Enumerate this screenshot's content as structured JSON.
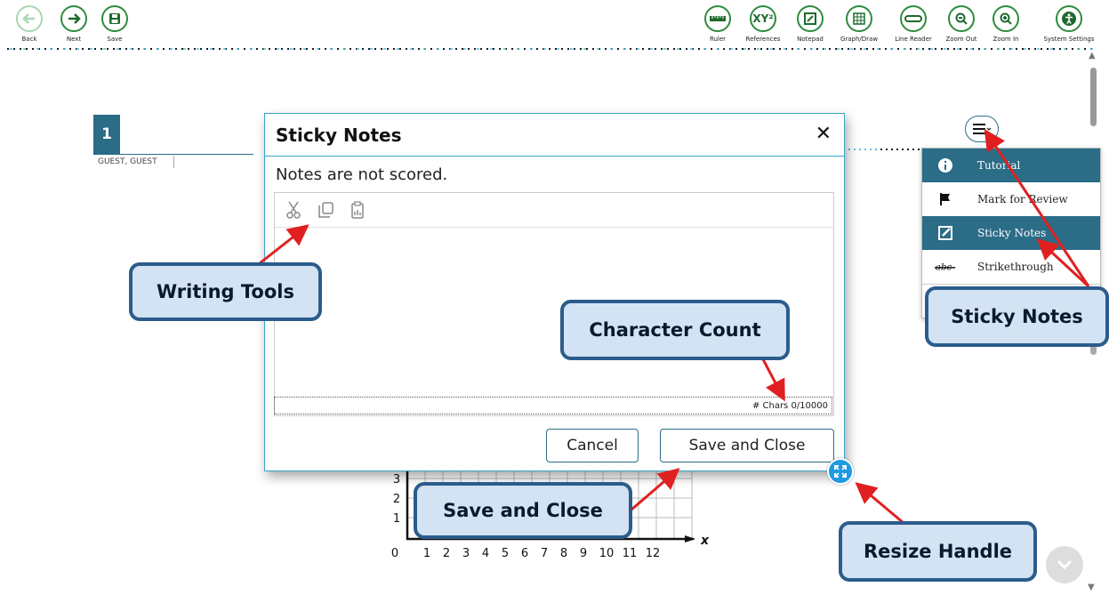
{
  "toolbar": {
    "left": [
      {
        "label": "Back",
        "icon": "back-arrow-icon",
        "disabled": true
      },
      {
        "label": "Next",
        "icon": "next-arrow-icon",
        "disabled": false
      },
      {
        "label": "Save",
        "icon": "save-disk-icon",
        "disabled": false
      }
    ],
    "right": [
      {
        "label": "Ruler",
        "icon": "ruler-icon"
      },
      {
        "label": "References",
        "icon": "references-icon",
        "glyph": "XY²"
      },
      {
        "label": "Notepad",
        "icon": "notepad-icon"
      },
      {
        "label": "Graph/Draw",
        "icon": "graph-draw-icon"
      },
      {
        "label": "Line Reader",
        "icon": "line-reader-icon"
      },
      {
        "label": "Zoom Out",
        "icon": "zoom-out-icon"
      },
      {
        "label": "Zoom In",
        "icon": "zoom-in-icon"
      },
      {
        "label": "System Settings",
        "icon": "system-settings-icon"
      }
    ],
    "accent": "#2e8b3e"
  },
  "question": {
    "number": "1",
    "student": "GUEST, GUEST"
  },
  "context_menu": {
    "items": [
      {
        "label": "Tutorial",
        "icon": "info-icon",
        "active": true
      },
      {
        "label": "Mark for Review",
        "icon": "flag-icon",
        "active": false
      },
      {
        "label": "Sticky Notes",
        "icon": "sticky-note-icon",
        "active": true
      },
      {
        "label": "Strikethrough",
        "icon": "strikethrough-icon",
        "active": false
      }
    ],
    "accent": "#2b6c87"
  },
  "dialog": {
    "title": "Sticky Notes",
    "close_glyph": "✕",
    "note": "Notes are not scored.",
    "tools": [
      "cut-icon",
      "copy-icon",
      "paste-icon"
    ],
    "char_count": "# Chars 0/10000",
    "cancel_label": "Cancel",
    "save_label": "Save and Close"
  },
  "graph": {
    "x_ticks": [
      "0",
      "1",
      "2",
      "3",
      "4",
      "5",
      "6",
      "7",
      "8",
      "9",
      "10",
      "11",
      "12"
    ],
    "y_ticks": [
      "1",
      "2",
      "3"
    ],
    "x_axis_label": "x"
  },
  "callouts": {
    "writing_tools": "Writing Tools",
    "character_count": "Character Count",
    "sticky_notes": "Sticky Notes",
    "save_and_close": "Save and Close",
    "resize_handle": "Resize Handle"
  },
  "colors": {
    "callout_fill": "#d3e3f3",
    "callout_border": "#2b5c8c",
    "arrow": "#e02020",
    "dialog_border": "#38a6c9"
  }
}
